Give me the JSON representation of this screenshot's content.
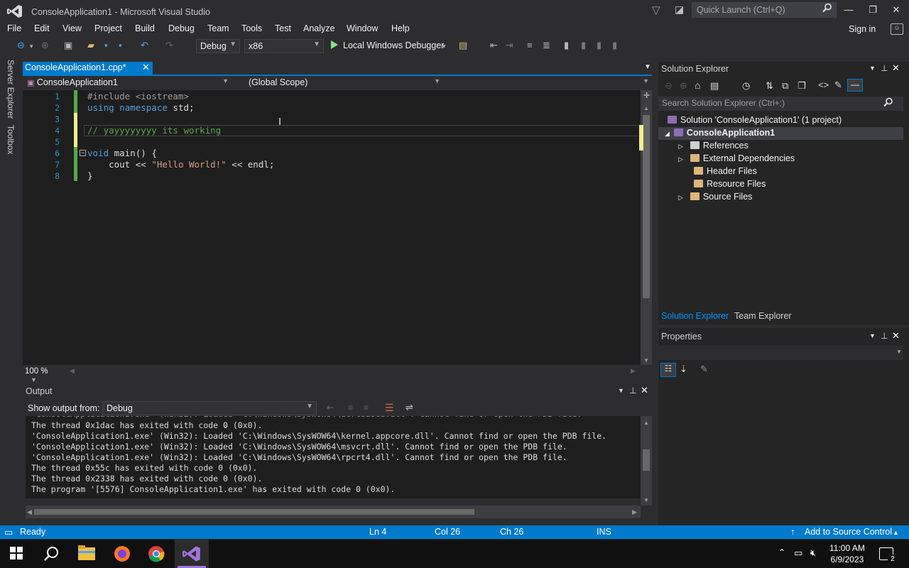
{
  "window": {
    "title": "ConsoleApplication1 - Microsoft Visual Studio",
    "quick_launch_placeholder": "Quick Launch (Ctrl+Q)",
    "sign_in": "Sign in"
  },
  "menu": [
    "File",
    "Edit",
    "View",
    "Project",
    "Build",
    "Debug",
    "Team",
    "Tools",
    "Test",
    "Analyze",
    "Window",
    "Help"
  ],
  "toolbar": {
    "configuration": "Debug",
    "platform": "x86",
    "debugger": "Local Windows Debugger"
  },
  "side_tabs": [
    "Server Explorer",
    "Toolbox"
  ],
  "editor": {
    "tab_label": "ConsoleApplication1.cpp*",
    "project_scope": "ConsoleApplication1",
    "scope": "(Global Scope)",
    "zoom": "100 %",
    "line_numbers": [
      "1",
      "2",
      "3",
      "4",
      "5",
      "6",
      "7",
      "8"
    ]
  },
  "output": {
    "title": "Output",
    "show_from_label": "Show output from:",
    "source": "Debug",
    "lines": [
      "The thread 0x1dac has exited with code 0 (0x0).",
      "'ConsoleApplication1.exe' (Win32): Loaded 'C:\\Windows\\SysWOW64\\kernel.appcore.dll'. Cannot find or open the PDB file.",
      "'ConsoleApplication1.exe' (Win32): Loaded 'C:\\Windows\\SysWOW64\\msvcrt.dll'. Cannot find or open the PDB file.",
      "'ConsoleApplication1.exe' (Win32): Loaded 'C:\\Windows\\SysWOW64\\rpcrt4.dll'. Cannot find or open the PDB file.",
      "The thread 0x55c has exited with code 0 (0x0).",
      "The thread 0x2338 has exited with code 0 (0x0).",
      "The program '[5576] ConsoleApplication1.exe' has exited with code 0 (0x0)."
    ]
  },
  "solution_explorer": {
    "title": "Solution Explorer",
    "search_placeholder": "Search Solution Explorer (Ctrl+;)",
    "solution": "Solution 'ConsoleApplication1' (1 project)",
    "project": "ConsoleApplication1",
    "nodes": [
      "References",
      "External Dependencies",
      "Header Files",
      "Resource Files",
      "Source Files"
    ],
    "bottom_tabs": [
      "Solution Explorer",
      "Team Explorer"
    ]
  },
  "properties": {
    "title": "Properties"
  },
  "status": {
    "state": "Ready",
    "ln": "Ln 4",
    "col": "Col 26",
    "ch": "Ch 26",
    "mode": "INS",
    "source_control": "Add to Source Control"
  },
  "taskbar": {
    "time": "11:00 AM",
    "date": "6/9/2023",
    "notifications": "2"
  },
  "colors": {
    "accent": "#007acc",
    "background": "#2d2d30",
    "editor": "#1e1e1e",
    "keyword": "#569cd6",
    "comment": "#57a64a",
    "string": "#d69d85",
    "line_number": "#2b91af"
  }
}
